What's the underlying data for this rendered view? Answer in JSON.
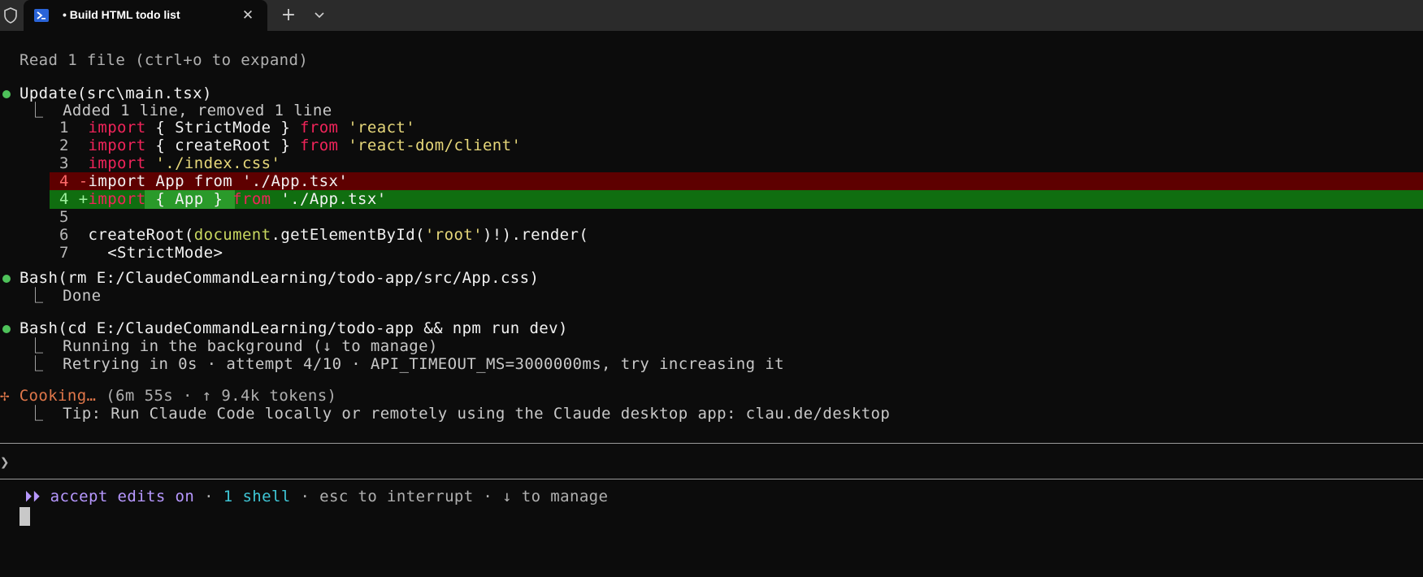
{
  "tab": {
    "title": "• Build HTML todo list",
    "close_label": "✕",
    "new_tab_label": "+"
  },
  "terminal": {
    "read_line": "Read 1 file (ctrl+o to expand)",
    "update": {
      "title": "Update(src\\main.tsx)",
      "summary": "⎿  Added 1 line, removed 1 line",
      "diff": [
        {
          "num": "1",
          "kw1": "import",
          "text1": " { StrictMode } ",
          "kw2": "from",
          "str": " 'react'"
        },
        {
          "num": "2",
          "kw1": "import",
          "text1": " { createRoot } ",
          "kw2": "from",
          "str": " 'react-dom/client'"
        },
        {
          "num": "3",
          "kw1": "import",
          "text1": "",
          "kw2": "",
          "str": " './index.css'"
        }
      ],
      "removed_line": {
        "num": "4",
        "sign": "-",
        "text": "import App from './App.tsx'"
      },
      "added_line": {
        "num": "4",
        "sign": "+",
        "kw1": "import",
        "text1": " { App } ",
        "kw2": "from",
        "str": " './App.tsx'"
      },
      "blank_num": "5",
      "line6": {
        "num": "6",
        "pre": "createRoot(",
        "doc": "document",
        "mid": ".getElementById(",
        "str": "'root'",
        "post": ")!).render("
      },
      "line7": {
        "num": "7",
        "text": "  <StrictMode>"
      }
    },
    "bash1": {
      "title": "Bash(rm E:/ClaudeCommandLearning/todo-app/src/App.css)",
      "result": "⎿  Done"
    },
    "bash2": {
      "title": "Bash(cd E:/ClaudeCommandLearning/todo-app && npm run dev)",
      "line1": "⎿  Running in the background (↓ to manage)",
      "line2": "⎿  Retrying in 0s · attempt 4/10 · API_TIMEOUT_MS=3000000ms, try increasing it"
    },
    "status": {
      "spinner": "✢",
      "label": "Cooking…",
      "detail": " (6m 55s · ↑ 9.4k tokens)",
      "tip": "⎿  Tip: Run Claude Code locally or remotely using the Claude desktop app: clau.de/desktop"
    },
    "prompt_symbol": "❯",
    "footer": {
      "arrows": "⏵⏵",
      "mode": " accept edits on",
      "sep1": " · ",
      "shells": "1 shell",
      "rest": " · esc to interrupt · ↓ to manage"
    }
  },
  "colors": {
    "bullet": "#4ec25a",
    "keyword": "#f0245a",
    "string": "#e6d77a",
    "removed_bg": "#5e0000",
    "added_bg": "#106e10",
    "spinner": "#e0774a",
    "mode": "#b798ff",
    "shell": "#3fc6d6"
  }
}
